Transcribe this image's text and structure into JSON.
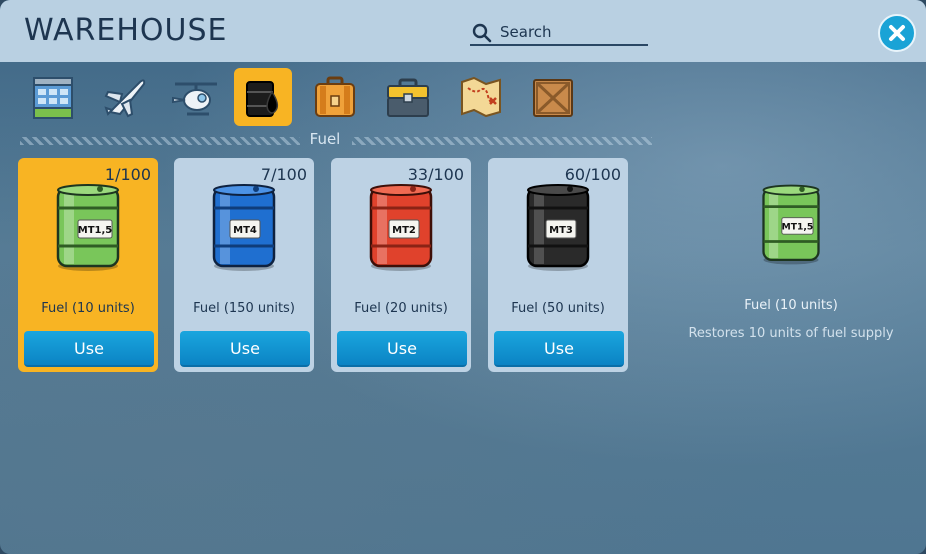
{
  "header": {
    "title": "WAREHOUSE",
    "search_placeholder": "Search"
  },
  "categories": [
    {
      "icon": "building-icon",
      "active": false
    },
    {
      "icon": "airplane-icon",
      "active": false
    },
    {
      "icon": "helicopter-icon",
      "active": false
    },
    {
      "icon": "oil-drop-icon",
      "active": true
    },
    {
      "icon": "suitcase-icon",
      "active": false
    },
    {
      "icon": "toolbox-icon",
      "active": false
    },
    {
      "icon": "treasure-map-icon",
      "active": false
    },
    {
      "icon": "wooden-crate-icon",
      "active": false
    }
  ],
  "section": {
    "label": "Fuel"
  },
  "items": [
    {
      "count": "1/100",
      "label": "MT1,5",
      "name": "Fuel (10 units)",
      "button": "Use",
      "color": "#79c65a",
      "selected": true
    },
    {
      "count": "7/100",
      "label": "MT4",
      "name": "Fuel (150 units)",
      "button": "Use",
      "color": "#1f6fd0",
      "selected": false
    },
    {
      "count": "33/100",
      "label": "MT2",
      "name": "Fuel (20 units)",
      "button": "Use",
      "color": "#e0422c",
      "selected": false
    },
    {
      "count": "60/100",
      "label": "MT3",
      "name": "Fuel (50 units)",
      "button": "Use",
      "color": "#2a2a2a",
      "selected": false
    }
  ],
  "detail": {
    "label": "MT1,5",
    "name": "Fuel (10 units)",
    "description": "Restores 10 units of fuel supply"
  },
  "colors": {
    "accent": "#f8b423",
    "button": "#1aa3d6",
    "header_bg": "#b9d0e2",
    "text_dark": "#1d3550"
  }
}
